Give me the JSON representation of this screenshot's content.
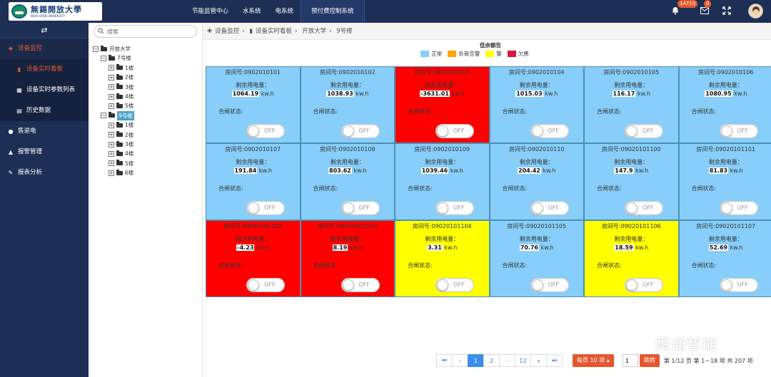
{
  "header": {
    "logo_cn": "無錫開放大學",
    "logo_en": "WUXI OPEN UNIVERSITY",
    "nav": [
      "节能监管中心",
      "水系统",
      "电系统",
      "预付费控制系统"
    ],
    "badge_alerts": "14715",
    "badge_mail": "0"
  },
  "sidebar": {
    "toggle": "⇄",
    "menu": [
      {
        "label": "设备监控",
        "icon": "pin-icon"
      },
      {
        "label": "设备实时看板",
        "icon": "bookmark-icon"
      },
      {
        "label": "设备实时参数列表",
        "icon": "grid-icon"
      },
      {
        "label": "历史数据",
        "icon": "book-icon"
      },
      {
        "label": "售退电",
        "icon": "location-icon"
      },
      {
        "label": "报警管理",
        "icon": "bell-icon"
      },
      {
        "label": "报表分析",
        "icon": "wrench-icon"
      }
    ]
  },
  "tree": {
    "search_placeholder": "搜索",
    "root": "开放大学",
    "b7": "7号楼",
    "b9": "9号楼",
    "floors7": [
      "1楼",
      "2楼",
      "3楼",
      "4楼",
      "5楼"
    ],
    "floors9": [
      "1楼",
      "2楼",
      "3楼",
      "4楼",
      "5楼",
      "6楼"
    ]
  },
  "breadcrumb": [
    "设备监控",
    "设备实时看板",
    "开放大学",
    "9号楼"
  ],
  "legend": {
    "title": "低余额告",
    "items": [
      {
        "label": "正常",
        "color": "#87cefa"
      },
      {
        "label": "负荷告警",
        "color": "#ffa500"
      },
      {
        "label": "警",
        "color": "#ffff00"
      },
      {
        "label": "欠费",
        "color": "#dc143c"
      }
    ]
  },
  "cells": [
    {
      "room": "房间号:0902010101",
      "rem_label": "剩余用电量：",
      "value": "1064.19",
      "unit": "kw.h",
      "switch_label": "合闸状态:",
      "switch": "OFF",
      "color": "#87cefa"
    },
    {
      "room": "房间号:0902010102",
      "rem_label": "剩余用电量：",
      "value": "1038.93",
      "unit": "kw.h",
      "switch_label": "合闸状态:",
      "switch": "OFF",
      "color": "#87cefa"
    },
    {
      "room": "房间号:0902010103",
      "rem_label": "剩余用电量：",
      "value": "-3631.01",
      "unit": "kw.h",
      "switch_label": "合闸状态:",
      "switch": "OFF",
      "color": "#ff0000"
    },
    {
      "room": "房间号:0902010104",
      "rem_label": "剩余用电量：",
      "value": "1015.03",
      "unit": "kw.h",
      "switch_label": "合闸状态:",
      "switch": "OFF",
      "color": "#87cefa"
    },
    {
      "room": "房间号:0902010105",
      "rem_label": "剩余用电量：",
      "value": "116.17",
      "unit": "kw.h",
      "switch_label": "合闸状态:",
      "switch": "OFF",
      "color": "#87cefa"
    },
    {
      "room": "房间号:0902010106",
      "rem_label": "剩余用电量：",
      "value": "1080.95",
      "unit": "kw.h",
      "switch_label": "合闸状态:",
      "switch": "OFF",
      "color": "#87cefa"
    },
    {
      "room": "房间号:0902010107",
      "rem_label": "剩余用电量：",
      "value": "191.84",
      "unit": "kw.h",
      "switch_label": "合闸状态:",
      "switch": "OFF",
      "color": "#87cefa"
    },
    {
      "room": "房间号:0902010108",
      "rem_label": "剩余用电量：",
      "value": "803.62",
      "unit": "kw.h",
      "switch_label": "合闸状态:",
      "switch": "OFF",
      "color": "#87cefa"
    },
    {
      "room": "房间号:0902010109",
      "rem_label": "剩余用电量：",
      "value": "1039.46",
      "unit": "kw.h",
      "switch_label": "合闸状态:",
      "switch": "OFF",
      "color": "#87cefa"
    },
    {
      "room": "房间号:0902010110",
      "rem_label": "剩余用电量：",
      "value": "204.42",
      "unit": "kw.h",
      "switch_label": "合闸状态:",
      "switch": "OFF",
      "color": "#87cefa"
    },
    {
      "room": "房间号:09020101100",
      "rem_label": "剩余用电量：",
      "value": "147.9",
      "unit": "kw.h",
      "switch_label": "合闸状态:",
      "switch": "OFF",
      "color": "#87cefa"
    },
    {
      "room": "房间号:09020101101",
      "rem_label": "剩余用电量：",
      "value": "81.83",
      "unit": "kw.h",
      "switch_label": "合闸状态:",
      "switch": "OFF",
      "color": "#87cefa"
    },
    {
      "room": "房间号:09020101102",
      "rem_label": "剩余用电量：",
      "value": "-4.23",
      "unit": "kw.h",
      "switch_label": "合闸状态:",
      "switch": "OFF",
      "color": "#ff0000"
    },
    {
      "room": "房间号:09020101103",
      "rem_label": "剩余用电量：",
      "value": "8.19",
      "unit": "kw.h",
      "switch_label": "合闸状态:",
      "switch": "OFF",
      "color": "#ff0000"
    },
    {
      "room": "房间号:09020101104",
      "rem_label": "剩余用电量：",
      "value": "3.31",
      "unit": "kw.h",
      "switch_label": "合闸状态:",
      "switch": "OFF",
      "color": "#ffff00"
    },
    {
      "room": "房间号:09020101105",
      "rem_label": "剩余用电量：",
      "value": "70.76",
      "unit": "kw.h",
      "switch_label": "合闸状态:",
      "switch": "OFF",
      "color": "#87cefa"
    },
    {
      "room": "房间号:09020101106",
      "rem_label": "剩余用电量：",
      "value": "18.59",
      "unit": "kw.h",
      "switch_label": "合闸状态:",
      "switch": "OFF",
      "color": "#ffff00"
    },
    {
      "room": "房间号:09020101107",
      "rem_label": "剩余用电量：",
      "value": "52.69",
      "unit": "kw.h",
      "switch_label": "合闸状态:",
      "switch": "OFF",
      "color": "#87cefa"
    }
  ],
  "pager": {
    "first": "⏮",
    "prev": "«",
    "p1": "1",
    "p2": "2",
    "ellipsis": "···",
    "p12": "12",
    "next": "»",
    "last": "⏭",
    "page_size": "每页 10 项 ▴",
    "jump_value": "1",
    "jump_btn": "跳转",
    "info": "第 1/12 页   第 1－18 项   共 207 项"
  },
  "watermark": "舜通智能"
}
